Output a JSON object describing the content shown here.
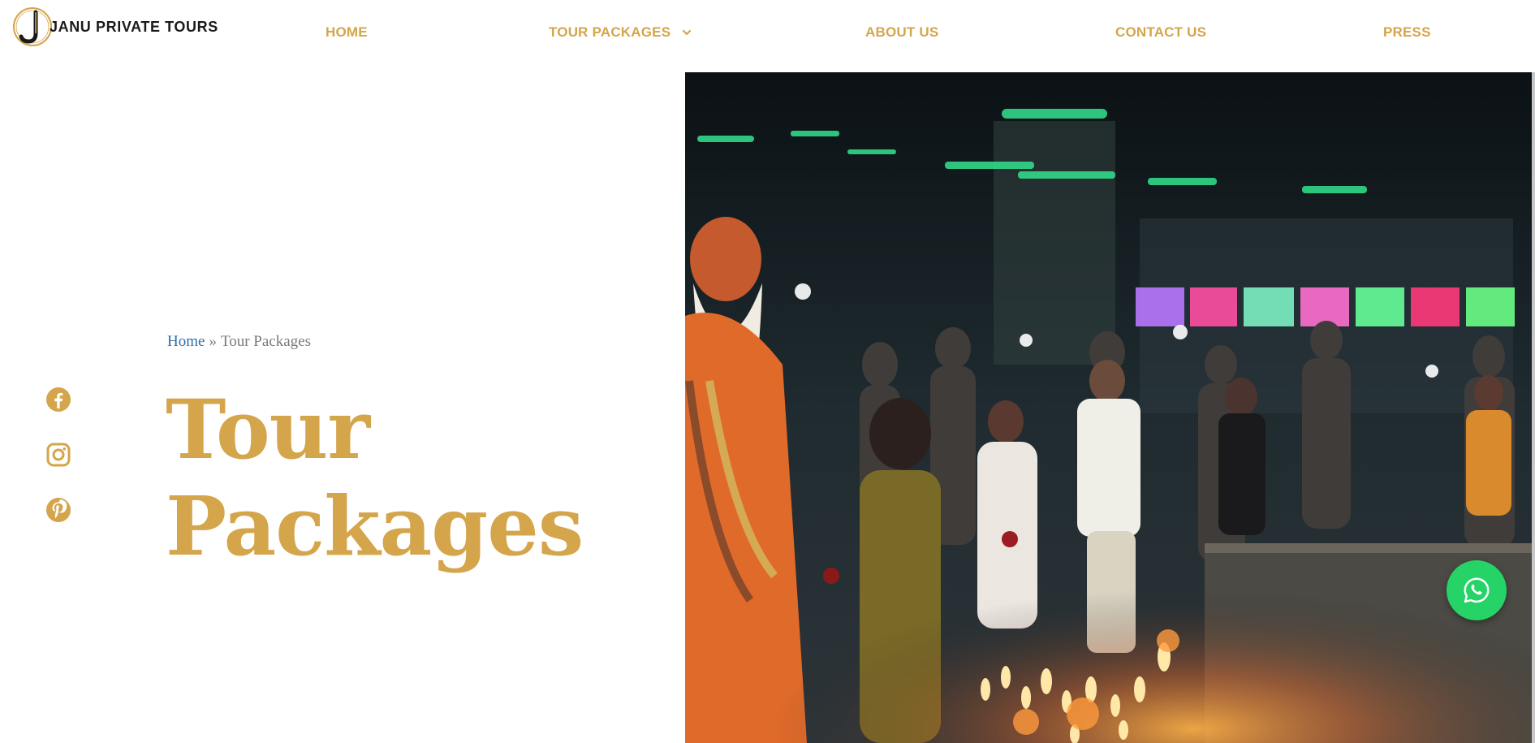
{
  "brand": {
    "name": "JANU PRIVATE TOURS",
    "logo_letter": "J"
  },
  "nav": {
    "items": [
      {
        "label": "HOME"
      },
      {
        "label": "TOUR PACKAGES",
        "has_dropdown": true
      },
      {
        "label": "ABOUT US"
      },
      {
        "label": "CONTACT US"
      },
      {
        "label": "PRESS"
      }
    ]
  },
  "breadcrumb": {
    "home": "Home",
    "separator": "»",
    "current": "Tour Packages"
  },
  "hero": {
    "title_line1": "Tour",
    "title_line2": "Packages"
  },
  "social": [
    "facebook-icon",
    "instagram-icon",
    "pinterest-icon"
  ],
  "colors": {
    "accent": "#d4a54a",
    "link": "#2f6fa8",
    "whatsapp": "#25d366"
  }
}
